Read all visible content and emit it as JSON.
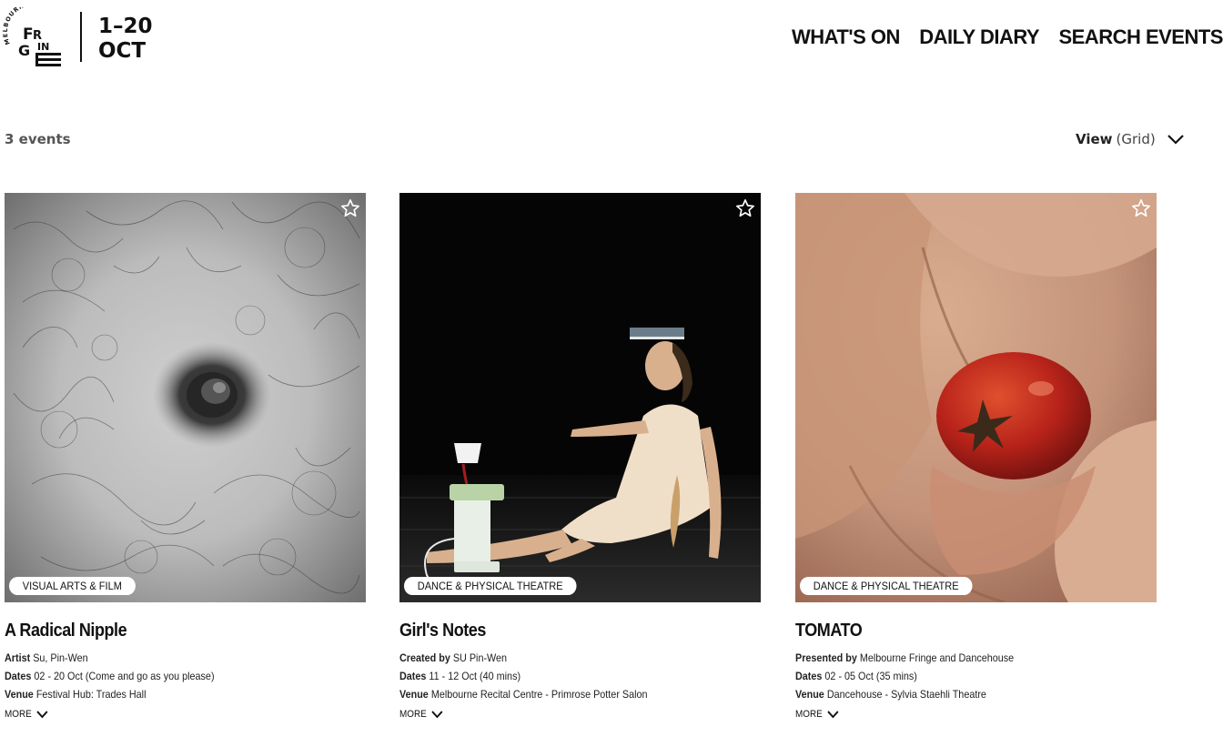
{
  "header": {
    "logo_text": "MELBOURNE FRINGE",
    "dates_line1": "1–20",
    "dates_line2": "OCT",
    "nav": [
      "WHAT'S ON",
      "DAILY DIARY",
      "SEARCH EVENTS"
    ]
  },
  "toolbar": {
    "results_count": "3 events",
    "view_label": "View",
    "view_value": "(Grid)"
  },
  "events": [
    {
      "tag": "VISUAL ARTS & FILM",
      "title": "A Radical Nipple",
      "credit_label": "Artist",
      "credit_value": "Su, Pin-Wen",
      "dates_label": "Dates",
      "dates_value": "02 - 20 Oct (Come and go as you please)",
      "venue_label": "Venue",
      "venue_value": "Festival Hub: Trades Hall",
      "more": "MORE"
    },
    {
      "tag": "DANCE & PHYSICAL THEATRE",
      "title": "Girl's Notes",
      "credit_label": "Created by",
      "credit_value": "SU Pin-Wen",
      "dates_label": "Dates",
      "dates_value": "11 - 12 Oct (40 mins)",
      "venue_label": "Venue",
      "venue_value": "Melbourne Recital Centre - Primrose Potter Salon",
      "more": "MORE"
    },
    {
      "tag": "DANCE & PHYSICAL THEATRE",
      "title": "TOMATO",
      "credit_label": "Presented by",
      "credit_value": "Melbourne Fringe and Dancehouse",
      "dates_label": "Dates",
      "dates_value": "02 - 05 Oct (35 mins)",
      "venue_label": "Venue",
      "venue_value": "Dancehouse - Sylvia Staehli Theatre",
      "more": "MORE"
    }
  ],
  "icons": {
    "favorite": "star-outline-icon",
    "dropdown": "chevron-down-icon"
  }
}
